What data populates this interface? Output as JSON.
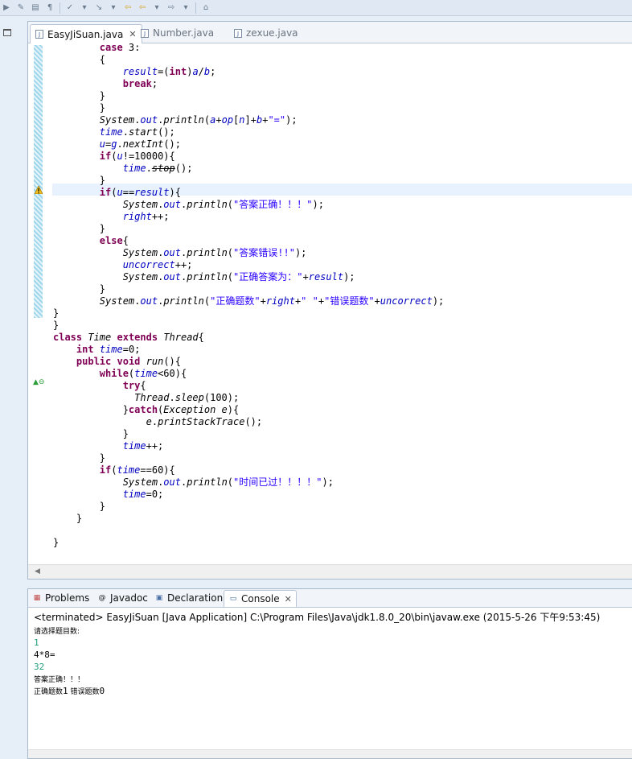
{
  "editor": {
    "tabs": [
      {
        "label": "EasyJiSuan.java",
        "active": true
      },
      {
        "label": "Number.java",
        "active": false
      },
      {
        "label": "zexue.java",
        "active": false
      }
    ],
    "code_lines": [
      "        case 3:",
      "        {",
      "            result=(int)a/b;",
      "            break;",
      "        }",
      "        }",
      "        System.out.println(a+op[n]+b+\"=\");",
      "        time.start();",
      "        u=g.nextInt();",
      "        if(u!=10000){",
      "            time.stop();",
      "        }",
      "        if(u==result){",
      "            System.out.println(\"答案正确！！！\");",
      "            right++;",
      "        }",
      "        else{",
      "            System.out.println(\"答案错误!!\");",
      "            uncorrect++;",
      "            System.out.println(\"正确答案为：\"+result);",
      "        }",
      "        System.out.println(\"正确题数\"+right+\" \"+\"错误题数\"+uncorrect);",
      "}",
      "}",
      "class Time extends Thread{",
      "    int time=0;",
      "    public void run(){",
      "        while(time<60){",
      "            try{",
      "              Thread.sleep(100);",
      "            }catch(Exception e){",
      "                e.printStackTrace();",
      "            }",
      "            time++;",
      "        }",
      "        if(time==60){",
      "            System.out.println(\"时间已过！！！！\");",
      "            time=0;",
      "        }",
      "    }",
      "",
      "}"
    ]
  },
  "console": {
    "tabs": [
      {
        "label": "Problems",
        "icon": "problems-icon"
      },
      {
        "label": "Javadoc",
        "icon": "at-icon"
      },
      {
        "label": "Declaration",
        "icon": "declaration-icon"
      },
      {
        "label": "Console",
        "icon": "console-icon",
        "active": true
      }
    ],
    "terminated_line": "<terminated> EasyJiSuan [Java Application] C:\\Program Files\\Java\\jdk1.8.0_20\\bin\\javaw.exe (2015-5-26 下午9:53:45)",
    "output": {
      "prompt": "请选择题目数:",
      "input1": "1",
      "question": "4*8=",
      "input2": "32",
      "result": "答案正确！！！",
      "summary_prefix": "正确题数",
      "right_count": "1",
      "summary_mid": " 错误题数",
      "wrong_count": "0"
    }
  }
}
